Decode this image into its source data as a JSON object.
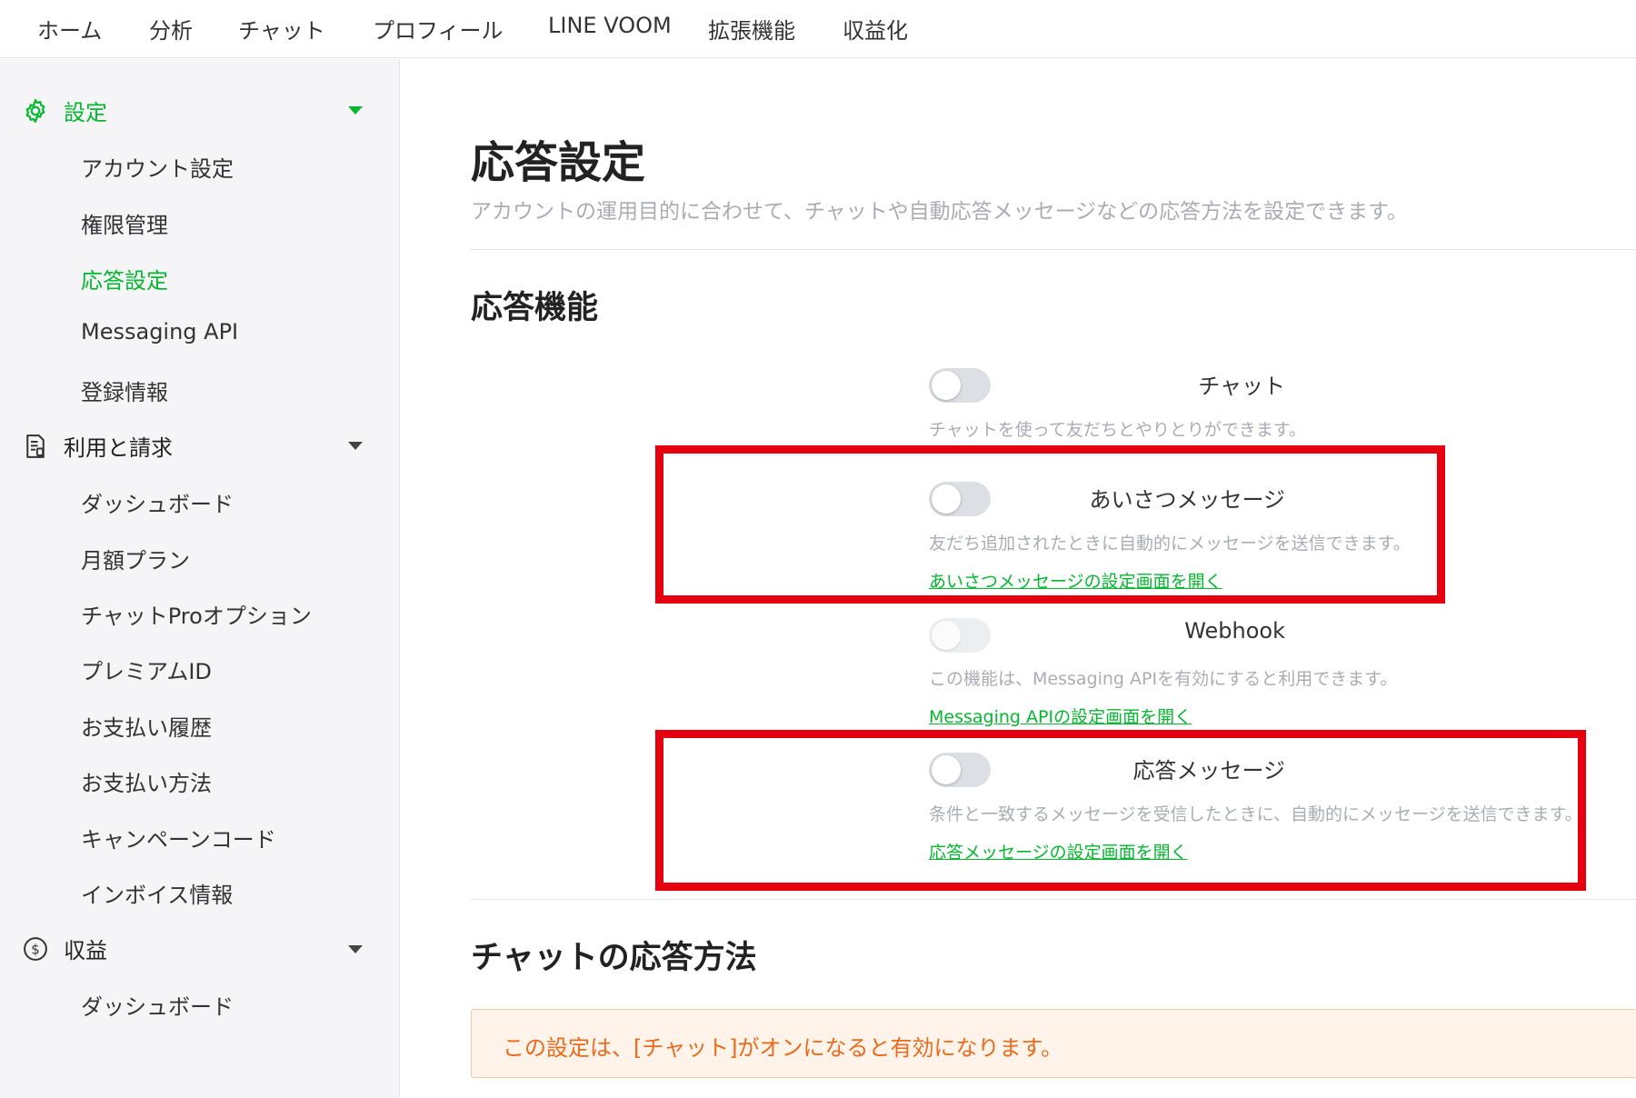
{
  "topnav": {
    "items": [
      "ホーム",
      "分析",
      "チャット",
      "プロフィール",
      "LINE VOOM",
      "拡張機能",
      "収益化"
    ]
  },
  "sidebar": {
    "settings": {
      "label": "設定",
      "icon": "gear-icon",
      "items": [
        "アカウント設定",
        "権限管理",
        "応答設定",
        "Messaging API",
        "登録情報"
      ],
      "active": "応答設定"
    },
    "billing": {
      "label": "利用と請求",
      "icon": "document-icon",
      "items": [
        "ダッシュボード",
        "月額プラン",
        "チャットProオプション",
        "プレミアムID",
        "お支払い履歴",
        "お支払い方法",
        "キャンペーンコード",
        "インボイス情報"
      ]
    },
    "revenue": {
      "label": "収益",
      "icon": "dollar-circle-icon",
      "items": [
        "ダッシュボード"
      ]
    }
  },
  "main": {
    "title": "応答設定",
    "description": "アカウントの運用目的に合わせて、チャットや自動応答メッセージなどの応答方法を設定できます。",
    "section1": {
      "title": "応答機能",
      "rows": [
        {
          "label": "チャット",
          "enabled": false,
          "disabled": false,
          "desc": "チャットを使って友だちとやりとりができます。",
          "link": ""
        },
        {
          "label": "あいさつメッセージ",
          "enabled": false,
          "disabled": false,
          "desc": "友だち追加されたときに自動的にメッセージを送信できます。",
          "link": "あいさつメッセージの設定画面を開く"
        },
        {
          "label": "Webhook",
          "enabled": false,
          "disabled": true,
          "desc": "この機能は、Messaging APIを有効にすると利用できます。",
          "link": "Messaging APIの設定画面を開く"
        },
        {
          "label": "応答メッセージ",
          "enabled": false,
          "disabled": false,
          "desc": "条件と一致するメッセージを受信したときに、自動的にメッセージを送信できます。",
          "link": "応答メッセージの設定画面を開く"
        }
      ]
    },
    "section2": {
      "title": "チャットの応答方法",
      "notice": "この設定は、[チャット]がオンになると有効になります。"
    }
  },
  "colors": {
    "accent_green": "#06b730",
    "highlight_red": "#e6000f",
    "notice_text": "#ec6a1b",
    "notice_bg": "#fff3ea"
  }
}
